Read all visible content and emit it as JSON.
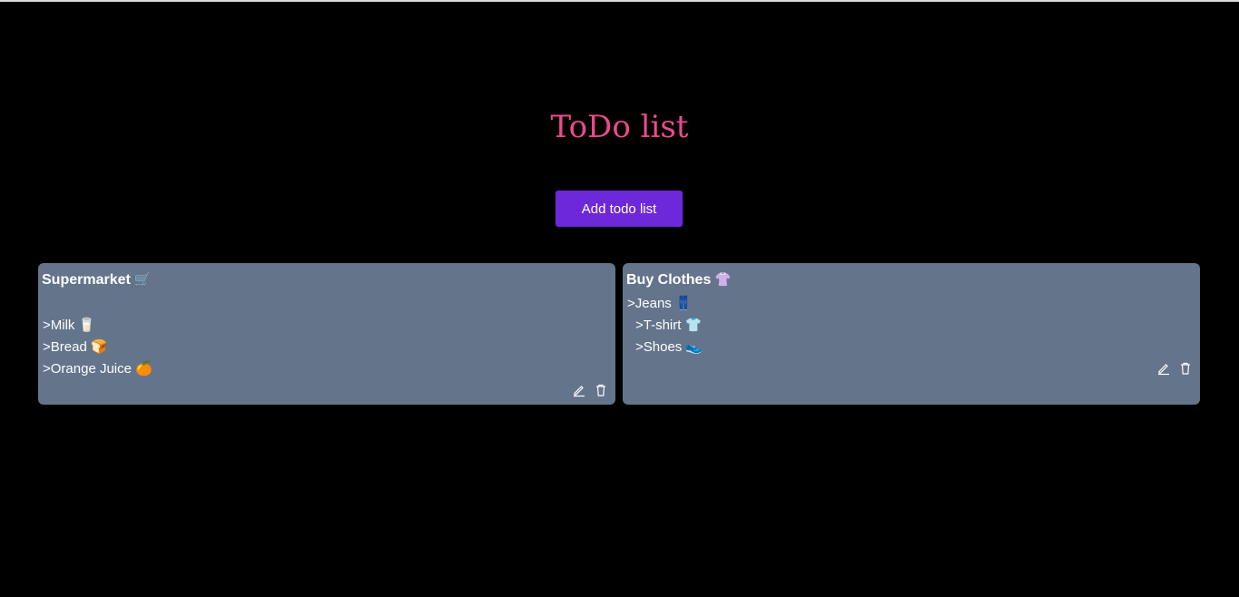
{
  "header": {
    "title": "ToDo list",
    "add_button_label": "Add todo list"
  },
  "lists": [
    {
      "title": "Supermarket",
      "title_emoji": "🛒",
      "items": [
        {
          "text": ">Milk",
          "emoji": "🥛"
        },
        {
          "text": ">Bread",
          "emoji": "🍞"
        },
        {
          "text": ">Orange Juice",
          "emoji": "🍊"
        }
      ],
      "edit_icon": "pencil-icon",
      "delete_icon": "trash-icon"
    },
    {
      "title": "Buy Clothes",
      "title_emoji": "👚",
      "items": [
        {
          "text": ">Jeans",
          "emoji": "👖"
        },
        {
          "text": ">T-shirt",
          "emoji": "👕"
        },
        {
          "text": ">Shoes",
          "emoji": "👟"
        }
      ],
      "edit_icon": "pencil-icon",
      "delete_icon": "trash-icon"
    }
  ],
  "colors": {
    "background": "#000000",
    "title": "#ec4a8c",
    "button": "#6d28d9",
    "card": "#64748b",
    "text": "#ffffff"
  }
}
